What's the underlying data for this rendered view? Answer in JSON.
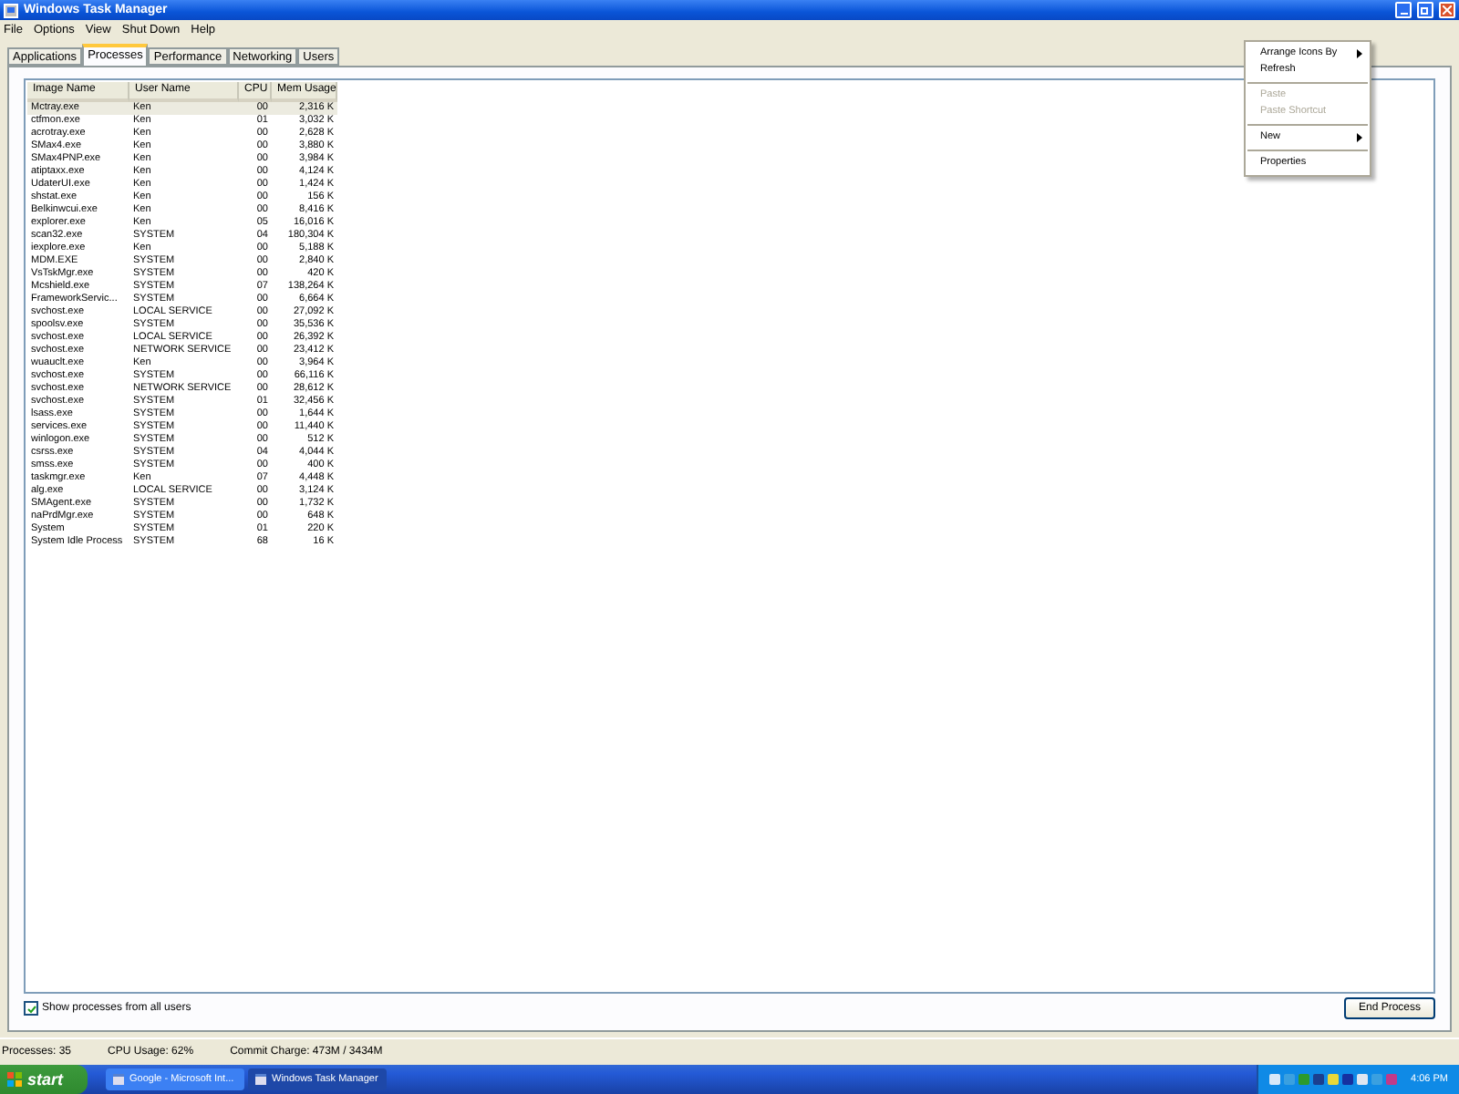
{
  "window": {
    "title": "Windows Task Manager"
  },
  "menu": [
    "File",
    "Options",
    "View",
    "Shut Down",
    "Help"
  ],
  "tabs": [
    {
      "label": "Applications",
      "selected": false
    },
    {
      "label": "Processes",
      "selected": true
    },
    {
      "label": "Performance",
      "selected": false
    },
    {
      "label": "Networking",
      "selected": false
    },
    {
      "label": "Users",
      "selected": false
    }
  ],
  "table": {
    "columns": [
      "Image Name",
      "User Name",
      "CPU",
      "Mem Usage"
    ],
    "rows": [
      {
        "name": "Mctray.exe",
        "user": "Ken",
        "cpu": "00",
        "mem": "2,316 K",
        "selected": true
      },
      {
        "name": "ctfmon.exe",
        "user": "Ken",
        "cpu": "01",
        "mem": "3,032 K",
        "selected": false
      },
      {
        "name": "acrotray.exe",
        "user": "Ken",
        "cpu": "00",
        "mem": "2,628 K",
        "selected": false
      },
      {
        "name": "SMax4.exe",
        "user": "Ken",
        "cpu": "00",
        "mem": "3,880 K",
        "selected": false
      },
      {
        "name": "SMax4PNP.exe",
        "user": "Ken",
        "cpu": "00",
        "mem": "3,984 K",
        "selected": false
      },
      {
        "name": "atiptaxx.exe",
        "user": "Ken",
        "cpu": "00",
        "mem": "4,124 K",
        "selected": false
      },
      {
        "name": "UdaterUI.exe",
        "user": "Ken",
        "cpu": "00",
        "mem": "1,424 K",
        "selected": false
      },
      {
        "name": "shstat.exe",
        "user": "Ken",
        "cpu": "00",
        "mem": "156 K",
        "selected": false
      },
      {
        "name": "Belkinwcui.exe",
        "user": "Ken",
        "cpu": "00",
        "mem": "8,416 K",
        "selected": false
      },
      {
        "name": "explorer.exe",
        "user": "Ken",
        "cpu": "05",
        "mem": "16,016 K",
        "selected": false
      },
      {
        "name": "scan32.exe",
        "user": "SYSTEM",
        "cpu": "04",
        "mem": "180,304 K",
        "selected": false
      },
      {
        "name": "iexplore.exe",
        "user": "Ken",
        "cpu": "00",
        "mem": "5,188 K",
        "selected": false
      },
      {
        "name": "MDM.EXE",
        "user": "SYSTEM",
        "cpu": "00",
        "mem": "2,840 K",
        "selected": false
      },
      {
        "name": "VsTskMgr.exe",
        "user": "SYSTEM",
        "cpu": "00",
        "mem": "420 K",
        "selected": false
      },
      {
        "name": "Mcshield.exe",
        "user": "SYSTEM",
        "cpu": "07",
        "mem": "138,264 K",
        "selected": false
      },
      {
        "name": "FrameworkServic...",
        "user": "SYSTEM",
        "cpu": "00",
        "mem": "6,664 K",
        "selected": false
      },
      {
        "name": "svchost.exe",
        "user": "LOCAL SERVICE",
        "cpu": "00",
        "mem": "27,092 K",
        "selected": false
      },
      {
        "name": "spoolsv.exe",
        "user": "SYSTEM",
        "cpu": "00",
        "mem": "35,536 K",
        "selected": false
      },
      {
        "name": "svchost.exe",
        "user": "LOCAL SERVICE",
        "cpu": "00",
        "mem": "26,392 K",
        "selected": false
      },
      {
        "name": "svchost.exe",
        "user": "NETWORK SERVICE",
        "cpu": "00",
        "mem": "23,412 K",
        "selected": false
      },
      {
        "name": "wuauclt.exe",
        "user": "Ken",
        "cpu": "00",
        "mem": "3,964 K",
        "selected": false
      },
      {
        "name": "svchost.exe",
        "user": "SYSTEM",
        "cpu": "00",
        "mem": "66,116 K",
        "selected": false
      },
      {
        "name": "svchost.exe",
        "user": "NETWORK SERVICE",
        "cpu": "00",
        "mem": "28,612 K",
        "selected": false
      },
      {
        "name": "svchost.exe",
        "user": "SYSTEM",
        "cpu": "01",
        "mem": "32,456 K",
        "selected": false
      },
      {
        "name": "lsass.exe",
        "user": "SYSTEM",
        "cpu": "00",
        "mem": "1,644 K",
        "selected": false
      },
      {
        "name": "services.exe",
        "user": "SYSTEM",
        "cpu": "00",
        "mem": "11,440 K",
        "selected": false
      },
      {
        "name": "winlogon.exe",
        "user": "SYSTEM",
        "cpu": "00",
        "mem": "512 K",
        "selected": false
      },
      {
        "name": "csrss.exe",
        "user": "SYSTEM",
        "cpu": "04",
        "mem": "4,044 K",
        "selected": false
      },
      {
        "name": "smss.exe",
        "user": "SYSTEM",
        "cpu": "00",
        "mem": "400 K",
        "selected": false
      },
      {
        "name": "taskmgr.exe",
        "user": "Ken",
        "cpu": "07",
        "mem": "4,448 K",
        "selected": false
      },
      {
        "name": "alg.exe",
        "user": "LOCAL SERVICE",
        "cpu": "00",
        "mem": "3,124 K",
        "selected": false
      },
      {
        "name": "SMAgent.exe",
        "user": "SYSTEM",
        "cpu": "00",
        "mem": "1,732 K",
        "selected": false
      },
      {
        "name": "naPrdMgr.exe",
        "user": "SYSTEM",
        "cpu": "00",
        "mem": "648 K",
        "selected": false
      },
      {
        "name": "System",
        "user": "SYSTEM",
        "cpu": "01",
        "mem": "220 K",
        "selected": false
      },
      {
        "name": "System Idle Process",
        "user": "SYSTEM",
        "cpu": "68",
        "mem": "16 K",
        "selected": false
      }
    ]
  },
  "show_all_users": {
    "label": "Show processes from all users",
    "checked": true
  },
  "end_process_button": "End Process",
  "status_bar": [
    "Processes: 35",
    "CPU Usage: 62%",
    "Commit Charge: 473M / 3434M"
  ],
  "context_menu": [
    {
      "kind": "item",
      "label": "Arrange Icons By",
      "submenu": true,
      "disabled": false
    },
    {
      "kind": "item",
      "label": "Refresh",
      "submenu": false,
      "disabled": false
    },
    {
      "kind": "separator"
    },
    {
      "kind": "item",
      "label": "Paste",
      "submenu": false,
      "disabled": true
    },
    {
      "kind": "item",
      "label": "Paste Shortcut",
      "submenu": false,
      "disabled": true
    },
    {
      "kind": "separator"
    },
    {
      "kind": "item",
      "label": "New",
      "submenu": true,
      "disabled": false
    },
    {
      "kind": "separator"
    },
    {
      "kind": "item",
      "label": "Properties",
      "submenu": false,
      "disabled": false
    }
  ],
  "taskbar": {
    "start": "start",
    "buttons": [
      {
        "label": "Google - Microsoft Int...",
        "selected": false
      },
      {
        "label": "Windows Task Manager",
        "selected": true
      }
    ],
    "clock": "4:06 PM"
  }
}
